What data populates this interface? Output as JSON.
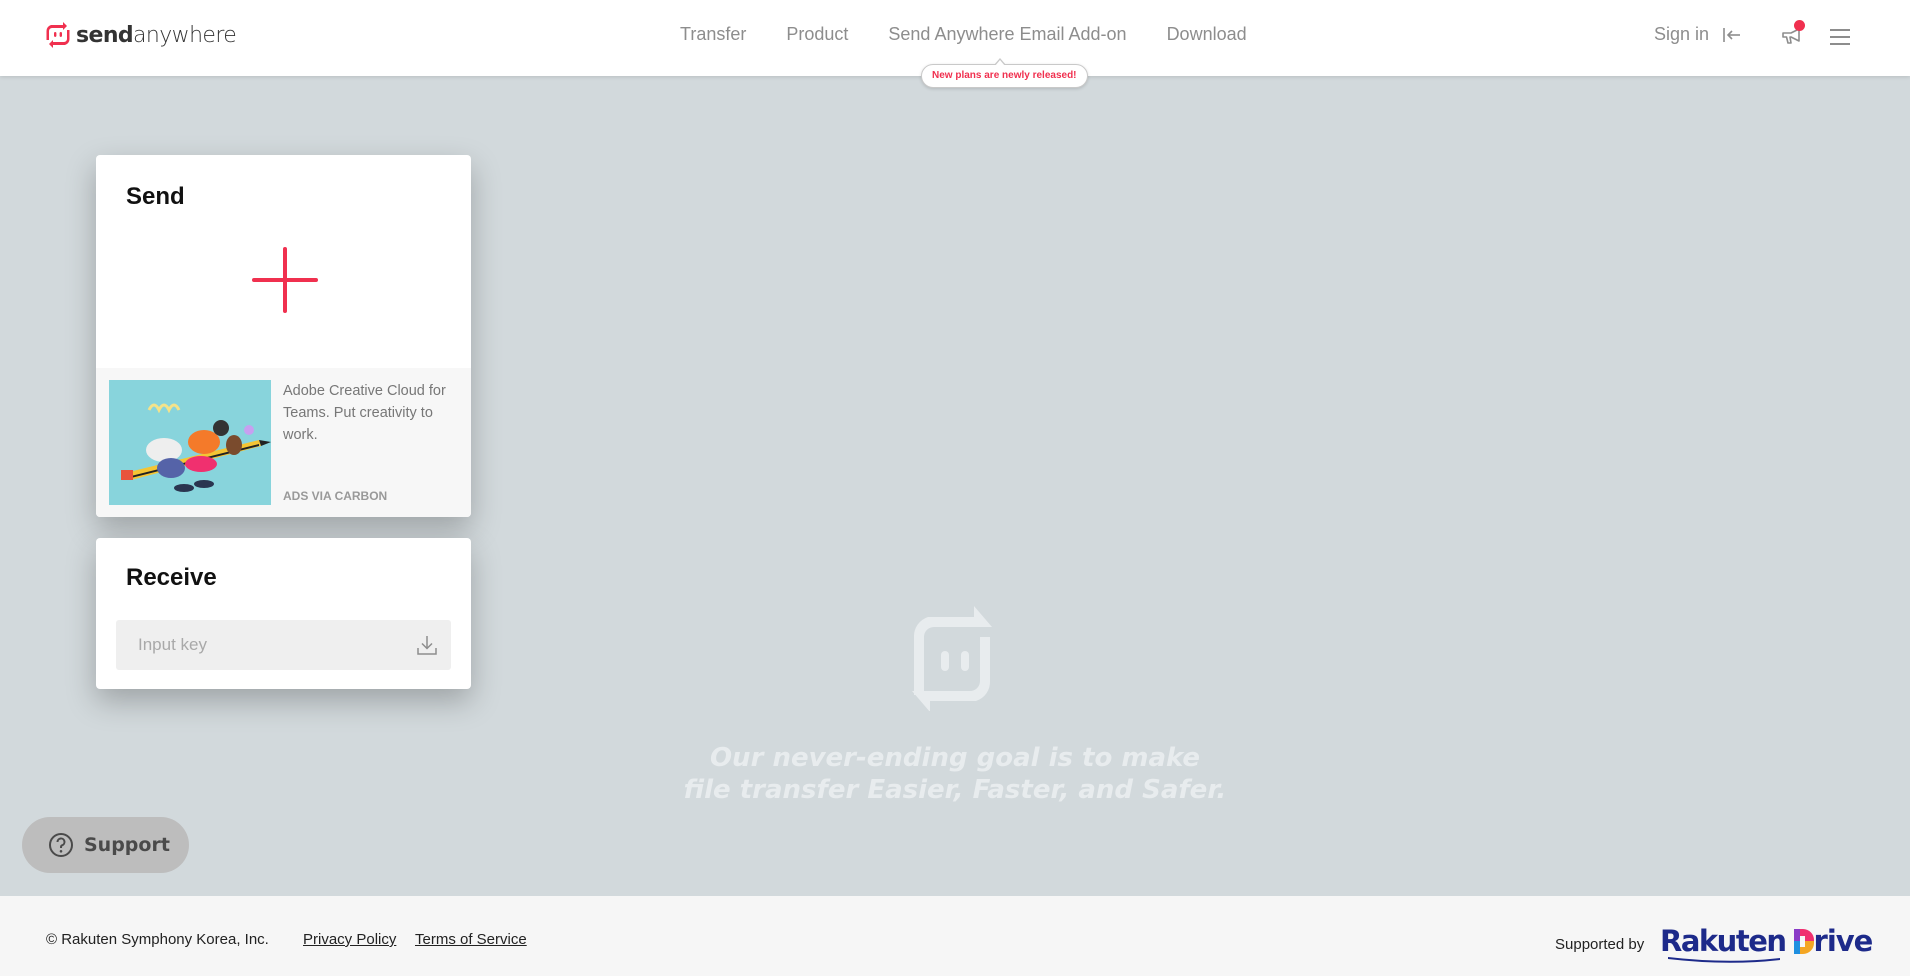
{
  "header": {
    "logo": {
      "bold": "send",
      "light": "anywhere",
      "icon": "sendanywhere-logo-icon"
    },
    "nav": [
      {
        "label": "Transfer"
      },
      {
        "label": "Product"
      },
      {
        "label": "Send Anywhere Email Add-on"
      },
      {
        "label": "Download"
      }
    ],
    "tooltip": "New plans are newly released!",
    "sign_in": "Sign in",
    "icons": {
      "sign_in": "sign-in-arrow-icon",
      "notifications": "megaphone-icon",
      "menu": "hamburger-menu-icon"
    }
  },
  "send": {
    "title": "Send",
    "add_icon": "plus-icon",
    "ad": {
      "text": "Adobe Creative Cloud for Teams. Put creativity to work.",
      "via": "ADS VIA CARBON"
    }
  },
  "receive": {
    "title": "Receive",
    "input_value": "",
    "input_placeholder": "Input key",
    "download_icon": "download-icon"
  },
  "watermark": {
    "line1": "Our never-ending goal is to make",
    "line2": "file transfer Easier, Faster, and Safer."
  },
  "support": {
    "label": "Support",
    "icon": "question-circle-icon"
  },
  "footer": {
    "copyright": "© Rakuten Symphony Korea, Inc.",
    "links": [
      {
        "label": "Privacy Policy"
      },
      {
        "label": "Terms of Service"
      }
    ],
    "supported_by": "Supported by",
    "brand_word": "Rakuten",
    "brand_product": "rive"
  },
  "colors": {
    "accent": "#f0304f",
    "background": "#d2d9dc",
    "header": "#ffffff",
    "footer": "#f6f6f6",
    "rakuten_blue": "#1d2a8a"
  }
}
